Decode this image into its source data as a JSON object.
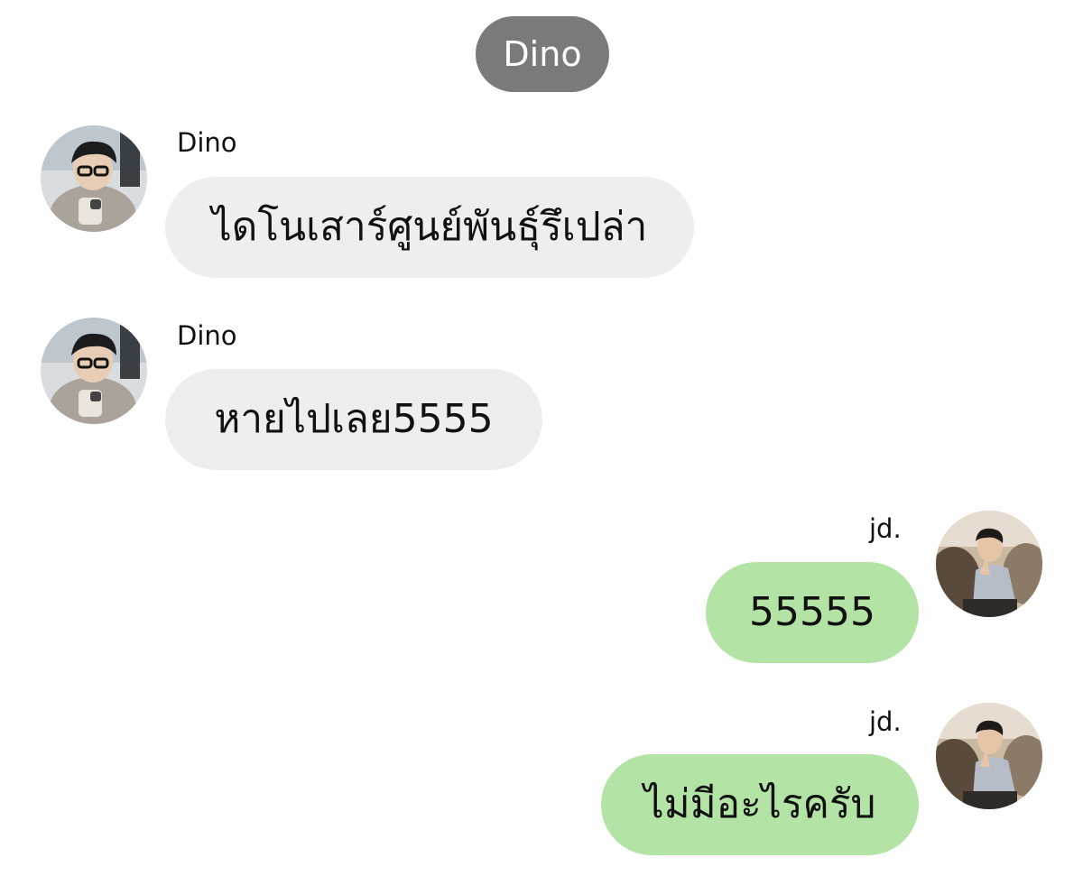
{
  "chat": {
    "title": "Dino",
    "messages": [
      {
        "sender": "Dino",
        "text": "ไดโนเสาร์ศูนย์พันธุ์รึเปล่า",
        "direction": "incoming"
      },
      {
        "sender": "Dino",
        "text": "หายไปเลย5555",
        "direction": "incoming"
      },
      {
        "sender": "jd.",
        "text": "55555",
        "direction": "outgoing"
      },
      {
        "sender": "jd.",
        "text": "ไม่มีอะไรครับ",
        "direction": "outgoing"
      }
    ]
  },
  "colors": {
    "header_bg": "#7a7a7a",
    "incoming_bubble": "#eeeeee",
    "outgoing_bubble": "#b3e4a6"
  }
}
